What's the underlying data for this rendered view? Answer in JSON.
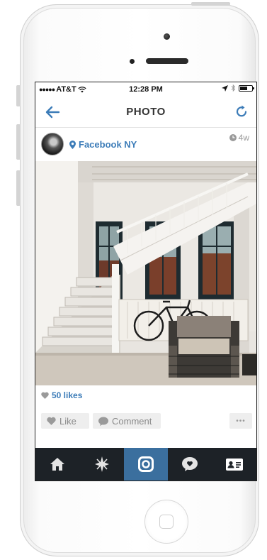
{
  "status_bar": {
    "carrier": "AT&T",
    "time": "12:28 PM"
  },
  "nav": {
    "title": "PHOTO"
  },
  "post": {
    "location": "Facebook NY",
    "time_ago": "4w",
    "likes": "50 likes"
  },
  "actions": {
    "like_label": "Like",
    "comment_label": "Comment",
    "more_label": "•••"
  },
  "tabs": [
    {
      "icon": "home-icon",
      "active": false
    },
    {
      "icon": "explore-star-icon",
      "active": false
    },
    {
      "icon": "camera-icon",
      "active": true
    },
    {
      "icon": "activity-heart-bubble-icon",
      "active": false
    },
    {
      "icon": "profile-card-icon",
      "active": false
    }
  ],
  "colors": {
    "link_blue": "#3c7cb8",
    "tab_bar": "#1d2227",
    "tab_active": "#3b6f9e"
  }
}
